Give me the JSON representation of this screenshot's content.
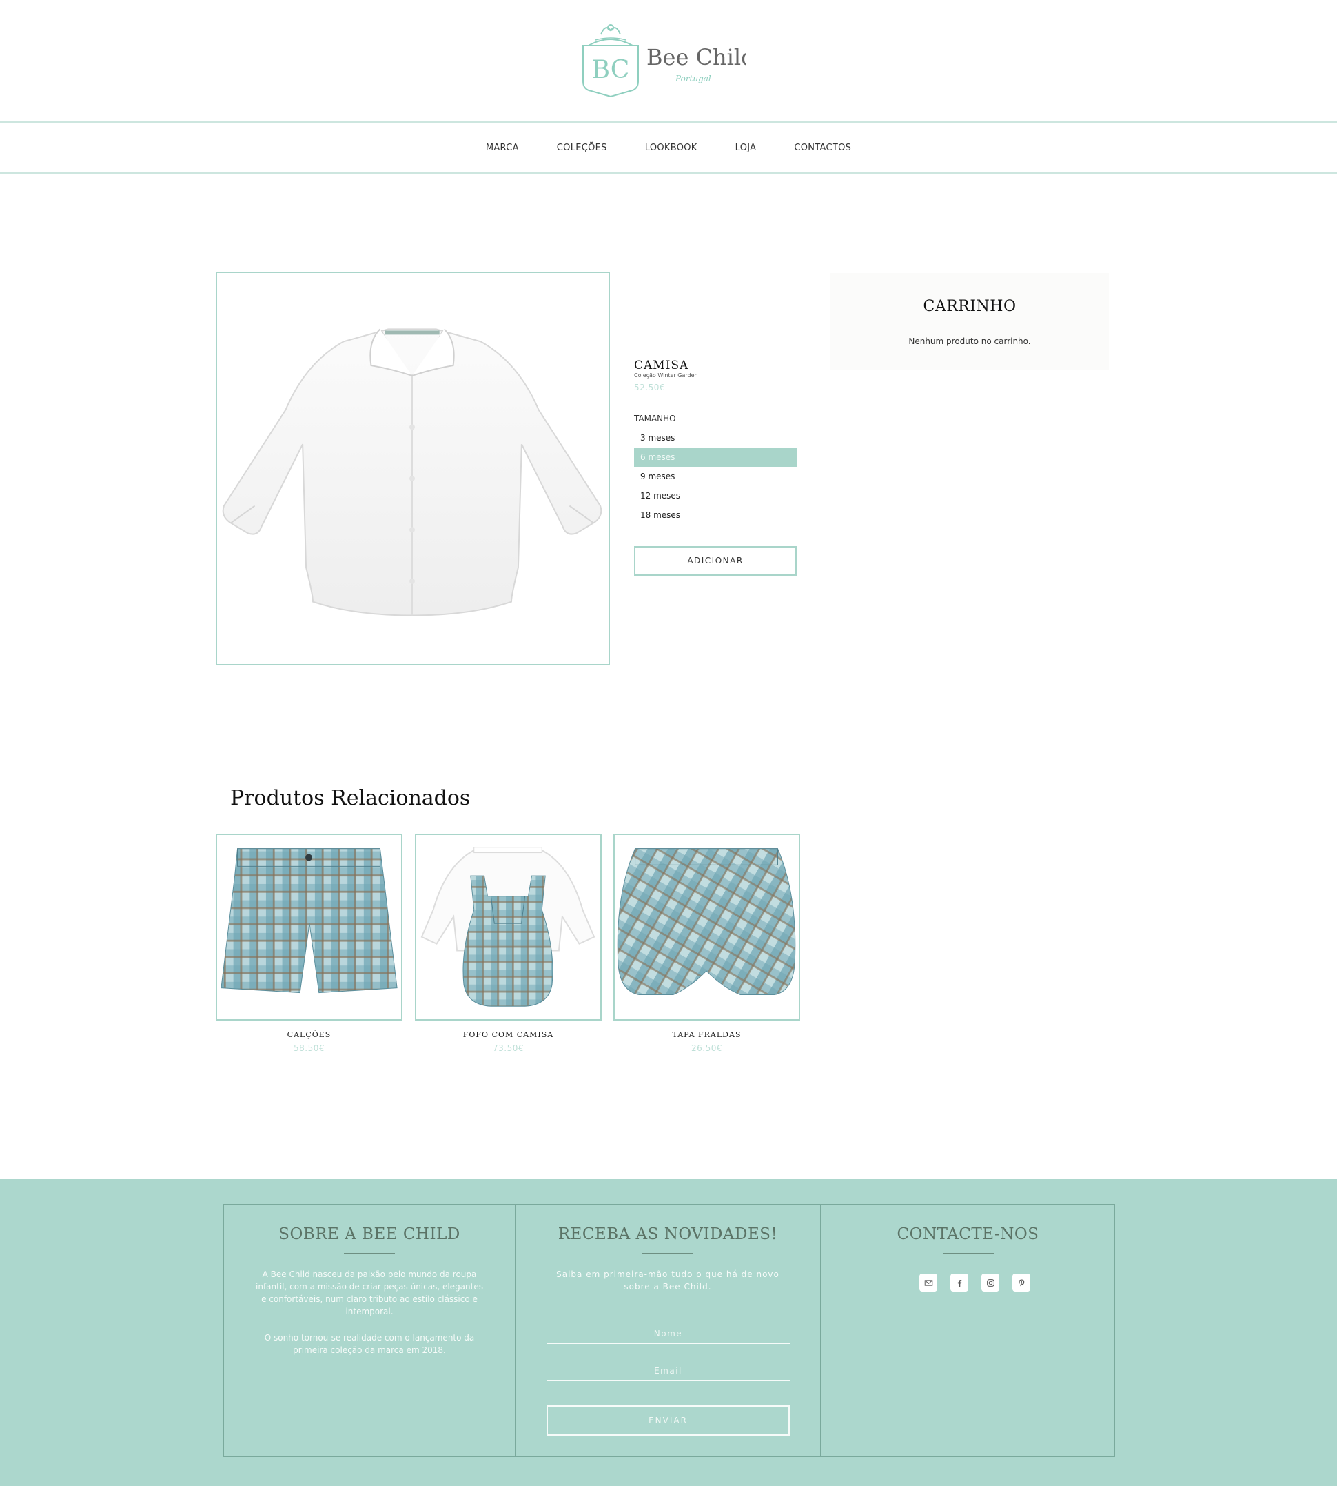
{
  "brand": {
    "monogram": "BC",
    "name": "Bee Child",
    "sub": "Portugal",
    "accent": "#a9d5ca",
    "logo_color": "#8fcfbf"
  },
  "nav": {
    "items": [
      "MARCA",
      "COLEÇÕES",
      "LOOKBOOK",
      "LOJA",
      "CONTACTOS"
    ]
  },
  "product": {
    "name": "CAMISA",
    "collection": "Coleção Winter Garden",
    "price": "52.50€",
    "size_label": "TAMANHO",
    "sizes": [
      "3 meses",
      "6 meses",
      "9 meses",
      "12 meses",
      "18 meses"
    ],
    "selected_size": "6 meses",
    "add_label": "ADICIONAR",
    "image_icon": "white-shirt-image"
  },
  "cart": {
    "title": "CARRINHO",
    "empty": "Nenhum produto no carrinho."
  },
  "related": {
    "title": "Produtos Relacionados",
    "items": [
      {
        "name": "CALÇÕES",
        "price": "58.50€",
        "image_icon": "plaid-shorts-image"
      },
      {
        "name": "FOFO COM CAMISA",
        "price": "73.50€",
        "image_icon": "plaid-romper-image"
      },
      {
        "name": "TAPA FRALDAS",
        "price": "26.50€",
        "image_icon": "plaid-bloomers-image"
      }
    ]
  },
  "footer": {
    "about": {
      "title": "SOBRE A BEE CHILD",
      "p1_lines": [
        "A Bee Child nasceu da paixão pelo mundo da roupa",
        "infantil, com a missão de criar peças únicas, elegantes",
        "e confortáveis, num claro tributo ao estilo clássico e",
        "intemporal."
      ],
      "p2_lines": [
        "O sonho tornou-se realidade com o lançamento da",
        "primeira coleção da marca em 2018."
      ]
    },
    "newsletter": {
      "title": "RECEBA AS NOVIDADES!",
      "text_lines": [
        "Saiba em primeira-mão tudo o que há de novo",
        "sobre a Bee Child."
      ],
      "name_placeholder": "Nome",
      "email_placeholder": "Email",
      "send_label": "ENVIAR"
    },
    "contact": {
      "title": "CONTACTE-NOS",
      "social_icons": [
        "email-icon",
        "facebook-icon",
        "instagram-icon",
        "pinterest-icon"
      ]
    },
    "background": "#acd7cd"
  }
}
